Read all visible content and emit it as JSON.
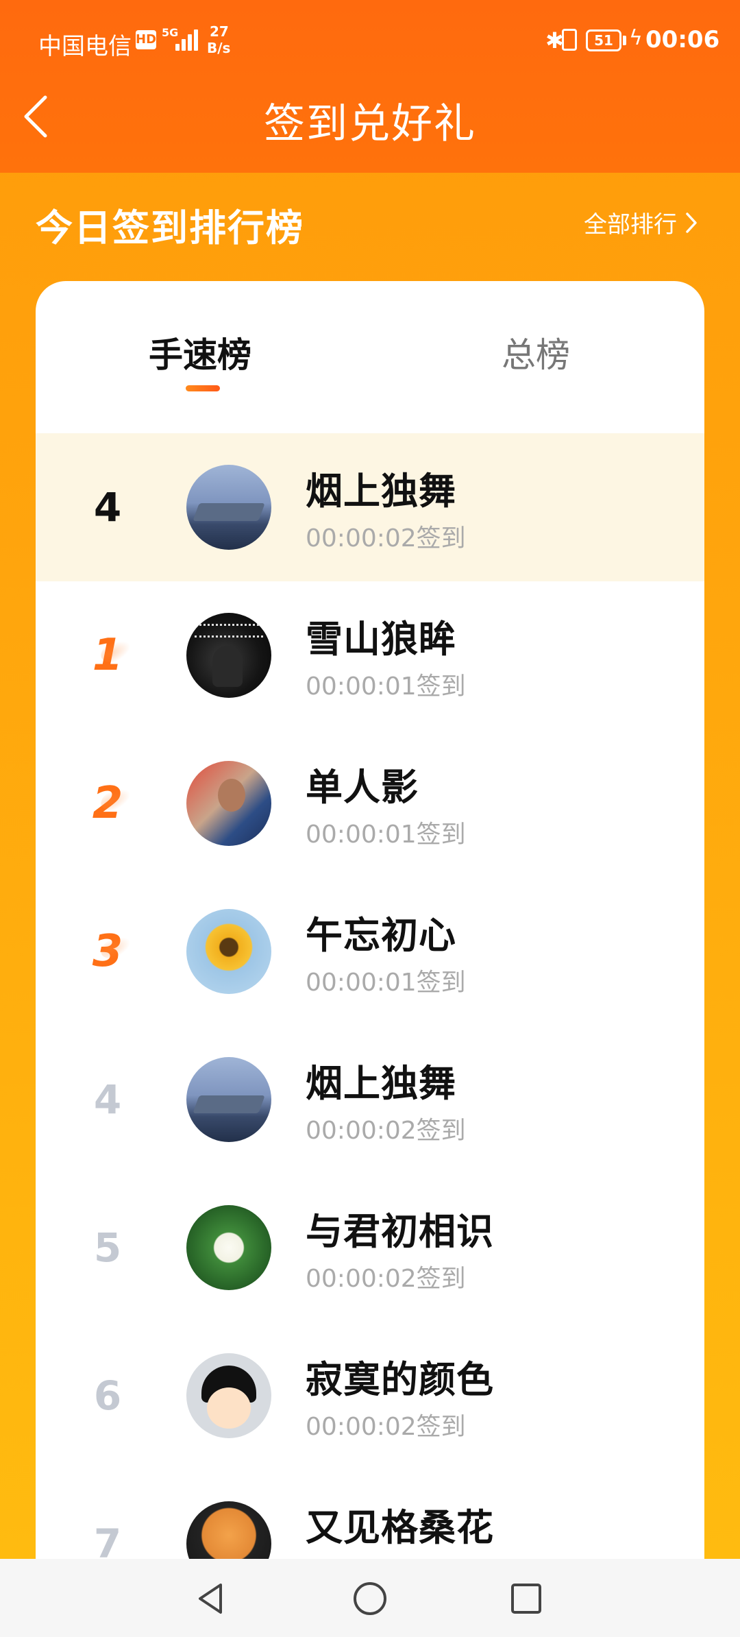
{
  "status_bar": {
    "carrier": "中国电信",
    "hd_badge": "HD",
    "network": "5G",
    "speed_value": "27",
    "speed_unit": "B/s",
    "battery": "51",
    "time": "00:06"
  },
  "nav": {
    "title": "签到兑好礼"
  },
  "section": {
    "title": "今日签到排行榜",
    "all_rank_link": "全部排行"
  },
  "tabs": [
    {
      "label": "手速榜",
      "active": true
    },
    {
      "label": "总榜",
      "active": false
    }
  ],
  "my_entry": {
    "rank": "4",
    "name": "烟上独舞",
    "checkin": "00:00:02签到",
    "avatar": "aircraft-carrier-avatar"
  },
  "entries": [
    {
      "rank": "1",
      "name": "雪山狼眸",
      "checkin": "00:00:01签到",
      "avatar": "hooded-figure-avatar"
    },
    {
      "rank": "2",
      "name": "单人影",
      "checkin": "00:00:01签到",
      "avatar": "football-player-avatar"
    },
    {
      "rank": "3",
      "name": "午忘初心",
      "checkin": "00:00:01签到",
      "avatar": "sunflower-avatar"
    },
    {
      "rank": "4",
      "name": "烟上独舞",
      "checkin": "00:00:02签到",
      "avatar": "aircraft-carrier-avatar"
    },
    {
      "rank": "5",
      "name": "与君初相识",
      "checkin": "00:00:02签到",
      "avatar": "lotus-avatar"
    },
    {
      "rank": "6",
      "name": "寂寞的颜色",
      "checkin": "00:00:02签到",
      "avatar": "cartoon-girl-avatar"
    },
    {
      "rank": "7",
      "name": "又见格桑花",
      "checkin": "",
      "avatar": "corgi-avatar"
    }
  ],
  "colors": {
    "header": "#ff6e0c",
    "background_top": "#ff9a0a",
    "background_bottom": "#ffbd10",
    "medal_rank": "#ff7016",
    "my_row_highlight": "#fdf6e3"
  }
}
